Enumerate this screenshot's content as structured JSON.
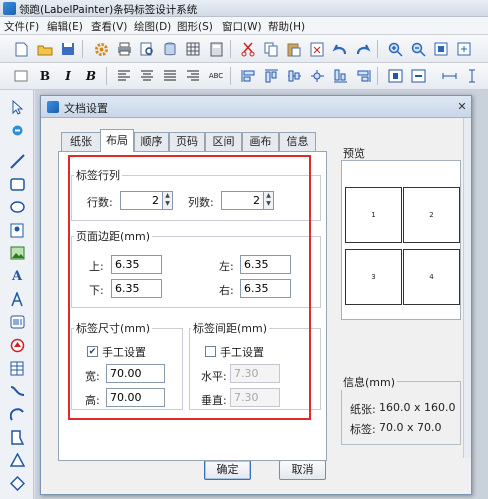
{
  "window": {
    "title": "领跑(LabelPainter)条码标签设计系统"
  },
  "menu": [
    "文件(F)",
    "编辑(E)",
    "查看(V)",
    "绘图(D)",
    "图形(S)",
    "窗口(W)",
    "帮助(H)"
  ],
  "toolbar2_text": {
    "bold": "B",
    "italic": "I",
    "bold_italic": "B",
    "abc": "ABC"
  },
  "dialog": {
    "title": "文档设置",
    "tabs": [
      "纸张",
      "布局",
      "顺序",
      "页码",
      "区间",
      "画布",
      "信息"
    ],
    "active_tab": "布局",
    "rows_cols": {
      "label": "标签行列",
      "rows_label": "行数:",
      "rows_value": "2",
      "cols_label": "列数:",
      "cols_value": "2"
    },
    "margins": {
      "label": "页面边距(mm)",
      "top_label": "上:",
      "top_value": "6.35",
      "left_label": "左:",
      "left_value": "6.35",
      "bottom_label": "下:",
      "bottom_value": "6.35",
      "right_label": "右:",
      "right_value": "6.35"
    },
    "label_size": {
      "label": "标签尺寸(mm)",
      "manual_label": "手工设置",
      "manual_checked": true,
      "width_label": "宽:",
      "width_value": "70.00",
      "height_label": "高:",
      "height_value": "70.00"
    },
    "label_gap": {
      "label": "标签间距(mm)",
      "manual_label": "手工设置",
      "manual_checked": false,
      "horizontal_label": "水平:",
      "horizontal_value": "7.30",
      "vertical_label": "垂直:",
      "vertical_value": "7.30"
    },
    "preview": {
      "label": "预览",
      "cells": [
        "1",
        "2",
        "3",
        "4"
      ]
    },
    "info": {
      "label": "信息(mm)",
      "paper_label": "纸张:",
      "paper_value": "160.0 x 160.0",
      "label_label": "标签:",
      "label_value": "70.0 x 70.0"
    },
    "ok_label": "确定",
    "cancel_label": "取消"
  },
  "colors": {
    "highlight": "#e02b2b",
    "accent": "#2057a8"
  }
}
